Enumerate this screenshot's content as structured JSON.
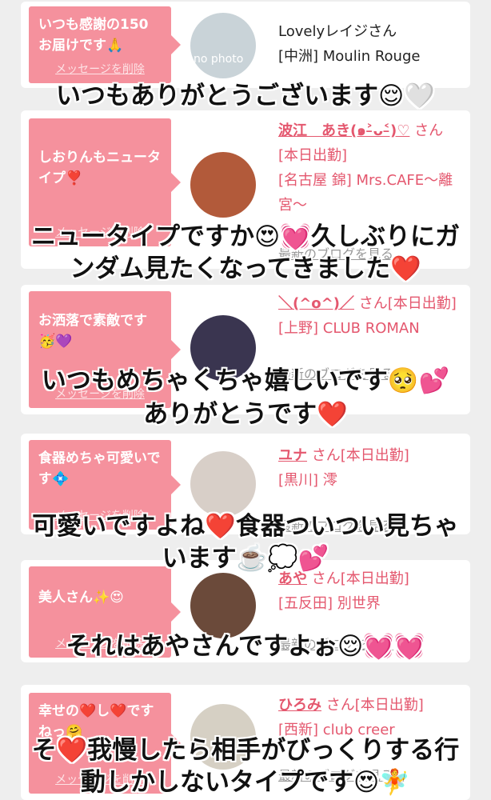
{
  "colors": {
    "accent": "#f5919d",
    "name_red": "#e4576e",
    "bg": "#eeeeee"
  },
  "cards": [
    {
      "bubble": "いつも感謝の150お届けです🙏",
      "delete": "メッセージを削除",
      "avatar_text": "no photo",
      "name": "Lovelyレイジさん",
      "shop": "[中洲] Moulin Rouge",
      "caption": "いつもありがとうございます😌🤍"
    },
    {
      "bubble": "しおりんもニュータイプ❣️",
      "delete": "メッセージを削除",
      "name": "波江　あき(๑˃̵ᴗ˂̵)♡",
      "honor": "さん[本日出勤]",
      "shop": "[名古屋 錦] Mrs.CAFE～離宮～",
      "blog": "最新のブログを見る",
      "caption1": "ニュータイプですか😍💓久しぶりにガ",
      "caption2": "ンダム見たくなってきました❤️"
    },
    {
      "bubble": "お洒落で素敵です🥳💜",
      "delete": "メッセージを削除",
      "name": "＼(^o^)／",
      "honor": "さん[本日出勤]",
      "shop": "[上野] CLUB ROMAN",
      "blog": "最新のブログを見る",
      "caption1": "いつもめちゃくちゃ嬉しいです🥺💕",
      "caption2": "ありがとうです❤️"
    },
    {
      "bubble": "食器めちゃ可愛いです💠",
      "delete": "メッセージを削除",
      "name": "ユナ",
      "honor": "さん[本日出勤]",
      "shop": "[黒川] 澪",
      "blog": "最新のブログを見る",
      "caption1": "可愛いですよね❤️食器ついつい見ちゃ",
      "caption2": "います☕️💭💕"
    },
    {
      "bubble": "美人さん✨😍",
      "delete": "メッセージを削除",
      "name": "あや",
      "honor": "さん[本日出勤]",
      "shop": "[五反田] 別世界",
      "blog": "最新のブログを見る",
      "caption": "それはあやさんですよぉ😌💓💓"
    },
    {
      "bubble": "幸せの❤️し❤️ですねっ🤗",
      "delete": "メッセージを削除",
      "name": "ひろみ",
      "honor": "さん[本日出勤]",
      "shop": "[西新] club creer",
      "blog": "最新のブログを見る",
      "caption1": "そ❤️我慢したら相手がびっくりする行",
      "caption2": "動しかしないタイプです😍🧚"
    }
  ]
}
